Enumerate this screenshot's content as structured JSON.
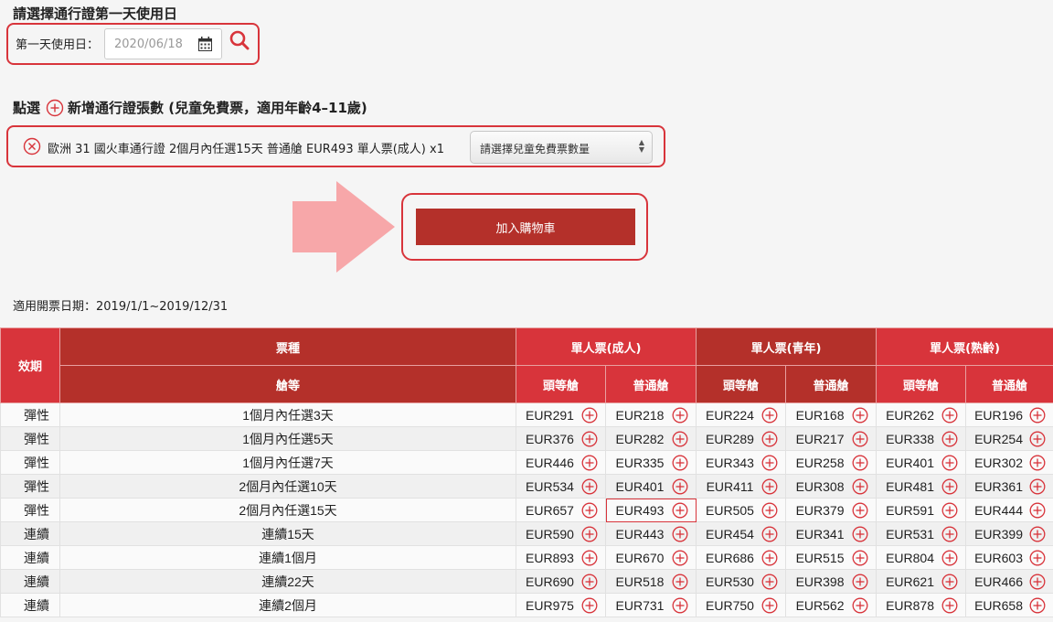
{
  "first_day": {
    "title": "請選擇通行證第一天使用日",
    "label": "第一天使用日：",
    "date_value": "2020/06/18"
  },
  "add_pass": {
    "prefix": "點選",
    "suffix": "新增通行證張數 (兒童免費票，適用年齡4–11歲)"
  },
  "selected_pass": {
    "description": "歐洲 31 國火車通行證 2個月內任選15天 普通艙 EUR493 單人票(成人) x1",
    "child_select_placeholder": "請選擇兒童免費票數量"
  },
  "cart": {
    "button_label": "加入購物車"
  },
  "validity": "適用開票日期：2019/1/1~2019/12/31",
  "colors": {
    "accent": "#d8343b",
    "accent_dark": "#b4302a"
  },
  "table": {
    "headers": {
      "validity": "效期",
      "ticket_type": "票種",
      "class": "艙等",
      "adult": "單人票(成人)",
      "youth": "單人票(青年)",
      "senior": "單人票(熟齡)",
      "first": "頭等艙",
      "second": "普通艙"
    },
    "rows": [
      {
        "type": "彈性",
        "name": "1個月內任選3天",
        "prices": [
          "EUR291",
          "EUR218",
          "EUR224",
          "EUR168",
          "EUR262",
          "EUR196"
        ]
      },
      {
        "type": "彈性",
        "name": "1個月內任選5天",
        "prices": [
          "EUR376",
          "EUR282",
          "EUR289",
          "EUR217",
          "EUR338",
          "EUR254"
        ]
      },
      {
        "type": "彈性",
        "name": "1個月內任選7天",
        "prices": [
          "EUR446",
          "EUR335",
          "EUR343",
          "EUR258",
          "EUR401",
          "EUR302"
        ]
      },
      {
        "type": "彈性",
        "name": "2個月內任選10天",
        "prices": [
          "EUR534",
          "EUR401",
          "EUR411",
          "EUR308",
          "EUR481",
          "EUR361"
        ]
      },
      {
        "type": "彈性",
        "name": "2個月內任選15天",
        "prices": [
          "EUR657",
          "EUR493",
          "EUR505",
          "EUR379",
          "EUR591",
          "EUR444"
        ],
        "selected_index": 1
      },
      {
        "type": "連續",
        "name": "連續15天",
        "prices": [
          "EUR590",
          "EUR443",
          "EUR454",
          "EUR341",
          "EUR531",
          "EUR399"
        ]
      },
      {
        "type": "連續",
        "name": "連續1個月",
        "prices": [
          "EUR893",
          "EUR670",
          "EUR686",
          "EUR515",
          "EUR804",
          "EUR603"
        ]
      },
      {
        "type": "連續",
        "name": "連續22天",
        "prices": [
          "EUR690",
          "EUR518",
          "EUR530",
          "EUR398",
          "EUR621",
          "EUR466"
        ]
      },
      {
        "type": "連續",
        "name": "連續2個月",
        "prices": [
          "EUR975",
          "EUR731",
          "EUR750",
          "EUR562",
          "EUR878",
          "EUR658"
        ]
      }
    ]
  }
}
